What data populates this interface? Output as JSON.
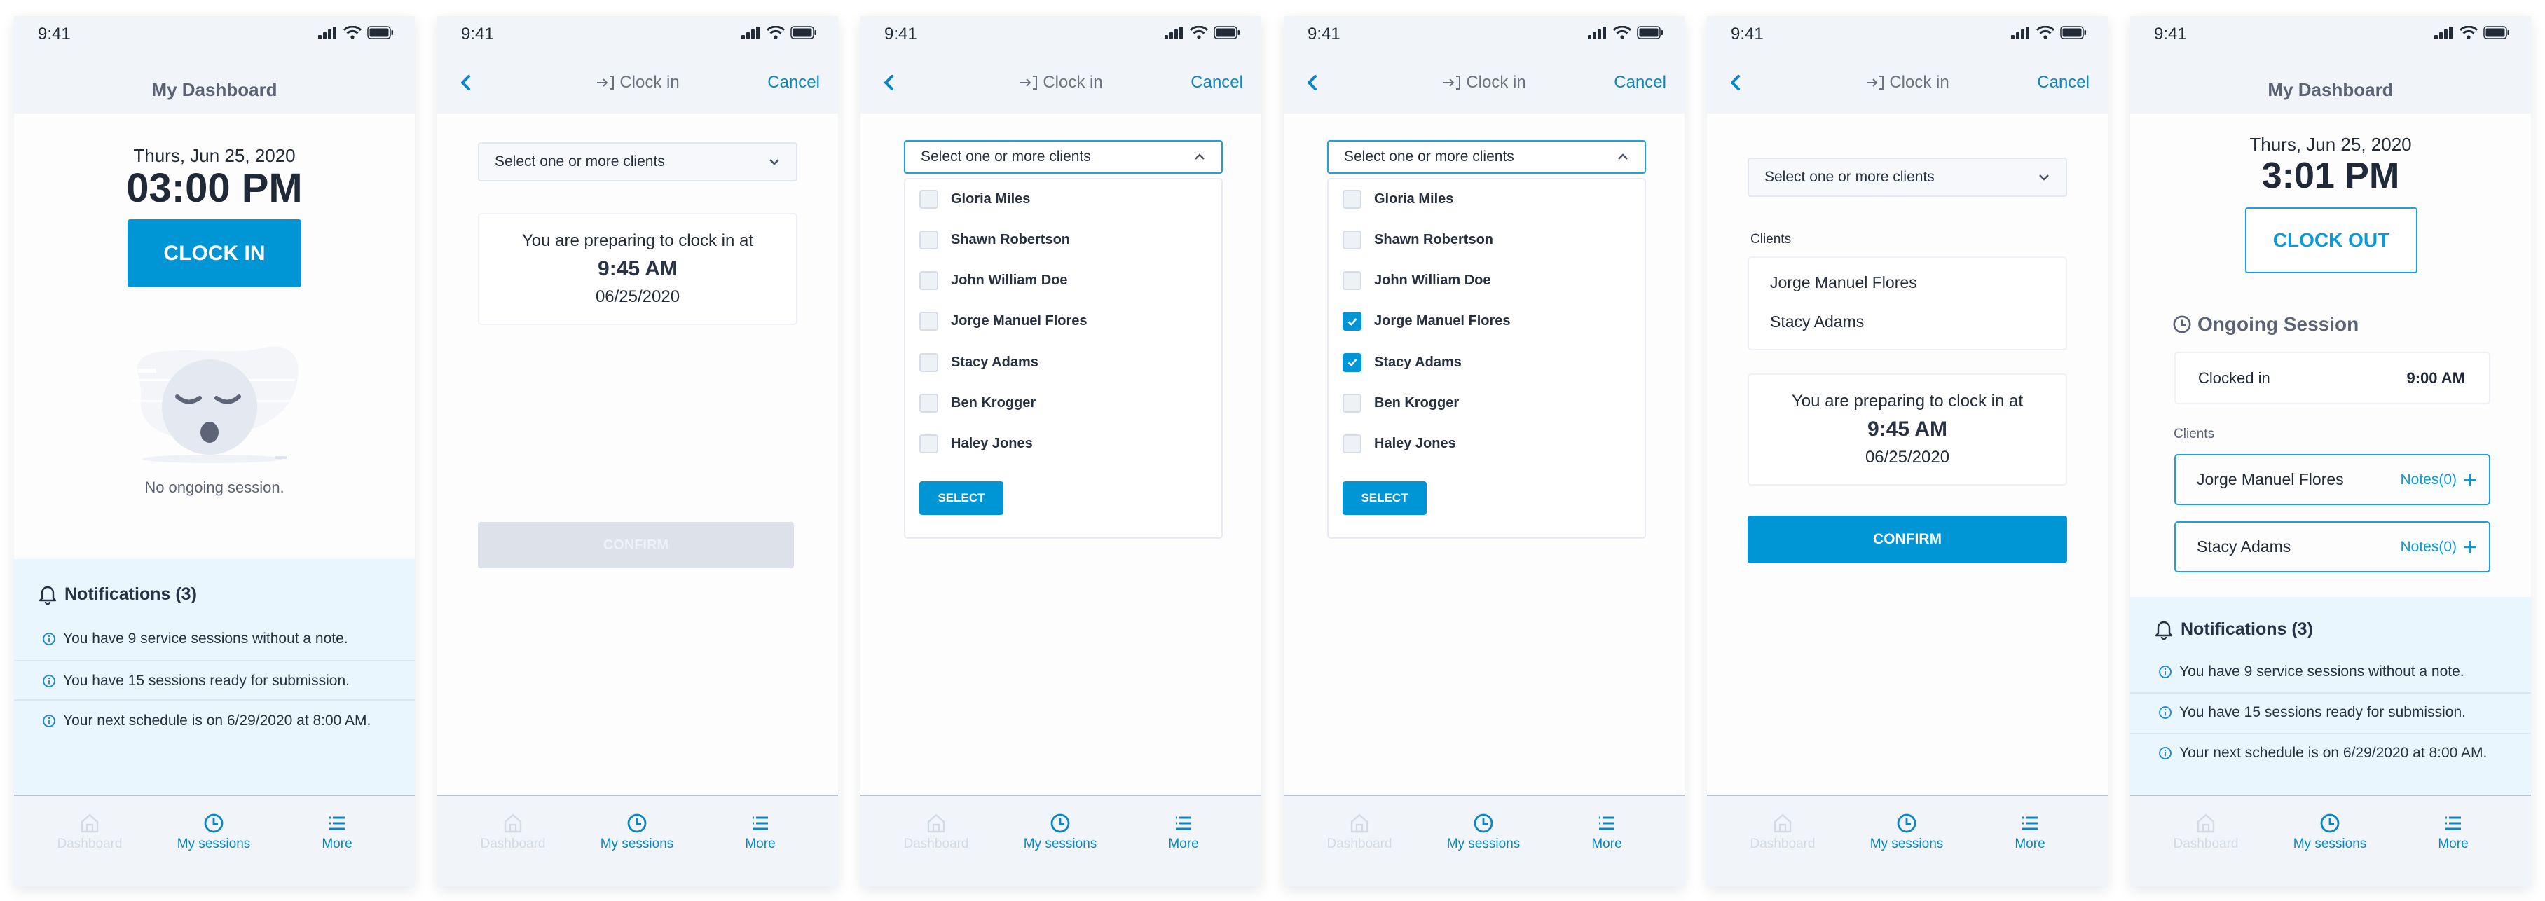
{
  "status_bar": {
    "time": "9:41"
  },
  "nav": {
    "items": [
      {
        "label": "Dashboard",
        "icon": "home-icon",
        "active": false
      },
      {
        "label": "My sessions",
        "icon": "clock-icon",
        "active": true
      },
      {
        "label": "More",
        "icon": "menu-icon",
        "active": true
      }
    ]
  },
  "colors": {
    "accent": "#0095d5",
    "header_bg": "#f1f5f9",
    "notification_bg": "#eaf6fd",
    "disabled": "#dde1ea"
  },
  "screens": [
    {
      "title": "My Dashboard",
      "date": "Thurs, Jun 25, 2020",
      "time": "03:00 PM",
      "clock_in_label": "CLOCK IN",
      "empty_state": "No ongoing session.",
      "notifications": {
        "title": "Notifications (3)",
        "items": [
          "You have 9 service sessions without a note.",
          "You have 15 sessions ready for submission.",
          "Your next schedule is on 6/29/2020 at 8:00 AM."
        ]
      }
    },
    {
      "title": "Clock in",
      "cancel": "Cancel",
      "dropdown_placeholder": "Select one or more clients",
      "prep_text": "You are preparing to clock in at",
      "prep_time": "9:45 AM",
      "prep_date": "06/25/2020",
      "confirm": "CONFIRM"
    },
    {
      "title": "Clock in",
      "cancel": "Cancel",
      "dropdown_placeholder": "Select one or more clients",
      "clients": [
        {
          "name": "Gloria Miles",
          "checked": false
        },
        {
          "name": "Shawn Robertson",
          "checked": false
        },
        {
          "name": "John William Doe",
          "checked": false
        },
        {
          "name": "Jorge Manuel Flores",
          "checked": false
        },
        {
          "name": "Stacy Adams",
          "checked": false
        },
        {
          "name": "Ben Krogger",
          "checked": false
        },
        {
          "name": "Haley Jones",
          "checked": false
        }
      ],
      "select_label": "SELECT"
    },
    {
      "title": "Clock in",
      "cancel": "Cancel",
      "dropdown_placeholder": "Select one or more clients",
      "clients": [
        {
          "name": "Gloria Miles",
          "checked": false
        },
        {
          "name": "Shawn Robertson",
          "checked": false
        },
        {
          "name": "John William Doe",
          "checked": false
        },
        {
          "name": "Jorge Manuel Flores",
          "checked": true
        },
        {
          "name": "Stacy Adams",
          "checked": true
        },
        {
          "name": "Ben Krogger",
          "checked": false
        },
        {
          "name": "Haley Jones",
          "checked": false
        }
      ],
      "select_label": "SELECT"
    },
    {
      "title": "Clock in",
      "cancel": "Cancel",
      "dropdown_placeholder": "Select one or more clients",
      "clients_label": "Clients",
      "selected_clients": [
        "Jorge Manuel Flores",
        "Stacy Adams"
      ],
      "prep_text": "You are preparing to clock in at",
      "prep_time": "9:45 AM",
      "prep_date": "06/25/2020",
      "confirm": "CONFIRM"
    },
    {
      "title": "My Dashboard",
      "date": "Thurs, Jun 25, 2020",
      "time": "3:01 PM",
      "clock_out_label": "CLOCK OUT",
      "session_title": "Ongoing Session",
      "clocked_in_label": "Clocked in",
      "clocked_in_time": "9:00 AM",
      "clients_label": "Clients",
      "clients": [
        {
          "name": "Jorge Manuel Flores",
          "notes": "Notes(0)"
        },
        {
          "name": "Stacy Adams",
          "notes": "Notes(0)"
        }
      ],
      "notifications": {
        "title": "Notifications (3)",
        "items": [
          "You have 9 service sessions without a note.",
          "You have 15 sessions ready for submission.",
          "Your next schedule is on 6/29/2020 at 8:00 AM."
        ]
      }
    }
  ]
}
